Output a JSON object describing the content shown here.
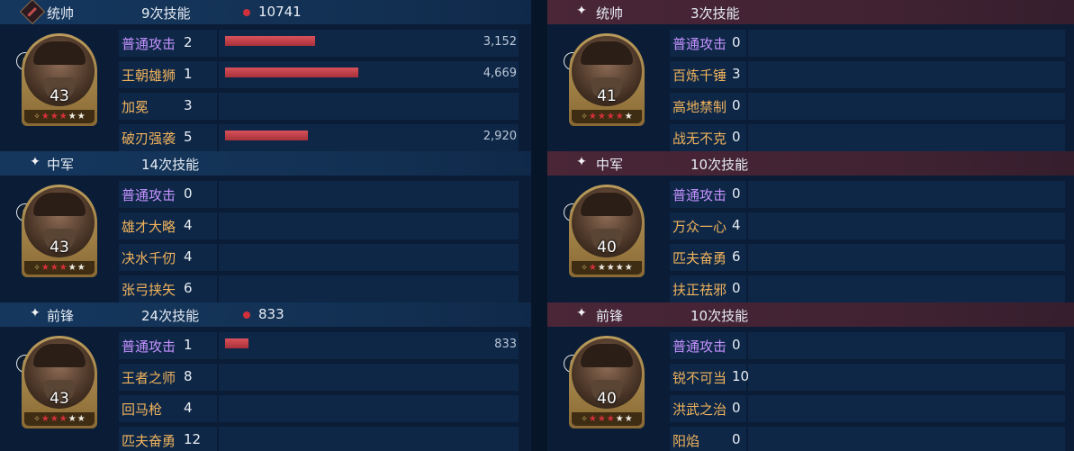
{
  "left": [
    {
      "role": "统帅",
      "header_icon": "commander-emblem-icon",
      "skill_count": "9次技能",
      "damage": "10741",
      "level": "43",
      "stars": {
        "pips": 1,
        "red": 3,
        "white": 2
      },
      "skills": [
        {
          "name": "普通攻击",
          "count": "2",
          "basic": true,
          "value": "3,152",
          "bar_pct": 0.215
        },
        {
          "name": "王朝雄狮",
          "count": "1",
          "basic": false,
          "value": "4,669",
          "bar_pct": 0.318
        },
        {
          "name": "加冕",
          "count": "3",
          "basic": false,
          "value": "",
          "bar_pct": 0
        },
        {
          "name": "破刃强袭",
          "count": "5",
          "basic": false,
          "value": "2,920",
          "bar_pct": 0.199
        }
      ]
    },
    {
      "role": "中军",
      "header_icon": "sparkle-icon",
      "skill_count": "14次技能",
      "damage": "",
      "level": "43",
      "stars": {
        "pips": 1,
        "red": 3,
        "white": 2
      },
      "skills": [
        {
          "name": "普通攻击",
          "count": "0",
          "basic": true,
          "value": "",
          "bar_pct": 0
        },
        {
          "name": "雄才大略",
          "count": "4",
          "basic": false,
          "value": "",
          "bar_pct": 0
        },
        {
          "name": "决水千仞",
          "count": "4",
          "basic": false,
          "value": "",
          "bar_pct": 0
        },
        {
          "name": "张弓挟矢",
          "count": "6",
          "basic": false,
          "value": "",
          "bar_pct": 0
        }
      ]
    },
    {
      "role": "前锋",
      "header_icon": "sparkle-icon",
      "skill_count": "24次技能",
      "damage": "833",
      "level": "43",
      "stars": {
        "pips": 1,
        "red": 3,
        "white": 2
      },
      "skills": [
        {
          "name": "普通攻击",
          "count": "1",
          "basic": true,
          "value": "833",
          "bar_pct": 0.057
        },
        {
          "name": "王者之师",
          "count": "8",
          "basic": false,
          "value": "",
          "bar_pct": 0
        },
        {
          "name": "回马枪",
          "count": "4",
          "basic": false,
          "value": "",
          "bar_pct": 0
        },
        {
          "name": "匹夫奋勇",
          "count": "12",
          "basic": false,
          "value": "",
          "bar_pct": 0
        }
      ]
    }
  ],
  "right": [
    {
      "role": "统帅",
      "header_icon": "sparkle-icon",
      "skill_count": "3次技能",
      "level": "41",
      "stars": {
        "pips": 1,
        "red": 4,
        "white": 1
      },
      "skills": [
        {
          "name": "普通攻击",
          "count": "0",
          "basic": true
        },
        {
          "name": "百炼千锤",
          "count": "3",
          "basic": false
        },
        {
          "name": "高地禁制",
          "count": "0",
          "basic": false
        },
        {
          "name": "战无不克",
          "count": "0",
          "basic": false
        }
      ]
    },
    {
      "role": "中军",
      "header_icon": "sparkle-icon",
      "skill_count": "10次技能",
      "level": "40",
      "stars": {
        "pips": 1,
        "red": 1,
        "white": 4
      },
      "skills": [
        {
          "name": "普通攻击",
          "count": "0",
          "basic": true
        },
        {
          "name": "万众一心",
          "count": "4",
          "basic": false
        },
        {
          "name": "匹夫奋勇",
          "count": "6",
          "basic": false
        },
        {
          "name": "扶正祛邪",
          "count": "0",
          "basic": false
        }
      ]
    },
    {
      "role": "前锋",
      "header_icon": "sparkle-icon",
      "skill_count": "10次技能",
      "level": "40",
      "stars": {
        "pips": 1,
        "red": 3,
        "white": 2
      },
      "skills": [
        {
          "name": "普通攻击",
          "count": "0",
          "basic": true
        },
        {
          "name": "锐不可当",
          "count": "10",
          "basic": false
        },
        {
          "name": "洪武之治",
          "count": "0",
          "basic": false
        },
        {
          "name": "阳焰",
          "count": "0",
          "basic": false
        }
      ]
    }
  ],
  "colors": {
    "ally_header": "#15375e",
    "enemy_header": "#4a2637",
    "basic_attack": "#c592ff",
    "skill": "#f0b35c",
    "damage_bar": "#c0404a",
    "red_star": "#d6303c"
  },
  "glyphs": {
    "sparkle": "✦",
    "troop": "♞",
    "star": "★",
    "pip": "✧"
  }
}
